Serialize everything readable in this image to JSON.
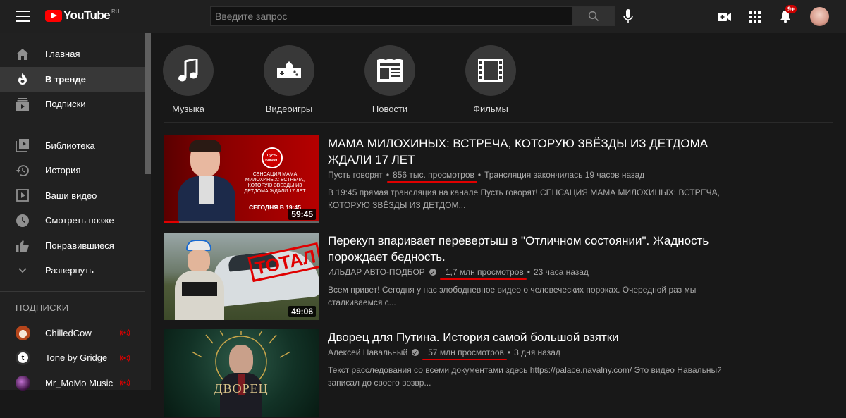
{
  "header": {
    "logo_text": "YouTube",
    "logo_region": "RU",
    "search_placeholder": "Введите запрос",
    "notification_badge": "9+"
  },
  "sidebar": {
    "main_items": [
      {
        "label": "Главная",
        "icon": "home-icon"
      },
      {
        "label": "В тренде",
        "icon": "trending-icon",
        "active": true
      },
      {
        "label": "Подписки",
        "icon": "subscriptions-icon"
      }
    ],
    "library_items": [
      {
        "label": "Библиотека",
        "icon": "library-icon"
      },
      {
        "label": "История",
        "icon": "history-icon"
      },
      {
        "label": "Ваши видео",
        "icon": "your-videos-icon"
      },
      {
        "label": "Смотреть позже",
        "icon": "watch-later-icon"
      },
      {
        "label": "Понравившиеся",
        "icon": "liked-icon"
      },
      {
        "label": "Развернуть",
        "icon": "chevron-down-icon"
      }
    ],
    "subscriptions_heading": "ПОДПИСКИ",
    "subscriptions": [
      {
        "label": "ChilledCow",
        "live": true
      },
      {
        "label": "Tone by Gridge",
        "live": true
      },
      {
        "label": "Mr_MoMo Music",
        "live": true
      }
    ]
  },
  "categories": [
    {
      "label": "Музыка",
      "icon": "music-icon"
    },
    {
      "label": "Видеоигры",
      "icon": "gamepad-icon"
    },
    {
      "label": "Новости",
      "icon": "news-icon"
    },
    {
      "label": "Фильмы",
      "icon": "film-icon"
    }
  ],
  "videos": [
    {
      "title": "МАМА МИЛОХИНЫХ: ВСТРЕЧА, КОТОРУЮ ЗВЁЗДЫ ИЗ ДЕТДОМА ЖДАЛИ 17 ЛЕТ",
      "channel": "Пусть говорят",
      "verified": false,
      "views": "856 тыс. просмотров",
      "time": "Трансляция закончилась 19 часов назад",
      "description": "В 19:45 прямая трансляция на канале Пусть говорят! СЕНСАЦИЯ МАМА МИЛОХИНЫХ: ВСТРЕЧА, КОТОРУЮ ЗВЁЗДЫ ИЗ ДЕТДОМ...",
      "duration": "59:45",
      "thumb_caption": "СЕНСАЦИЯ МАМА МИЛОХИНЫХ: ВСТРЕЧА, КОТОРУЮ ЗВЁЗДЫ ИЗ ДЕТДОМА ЖДАЛИ 17 ЛЕТ",
      "thumb_caption2": "СЕГОДНЯ В 19:45",
      "thumb_logo": "Пусть говорят",
      "watched_fraction": 0.1
    },
    {
      "title": "Перекуп впаривает перевертыш в \"Отличном состоянии\". Жадность порождает бедность.",
      "channel": "ИЛЬДАР АВТО-ПОДБОР",
      "verified": true,
      "views": "1,7 млн просмотров",
      "time": "23 часа назад",
      "description": "Всем привет! Сегодня у нас злободневное видео о человеческих пороках. Очередной раз мы сталкиваемся с...",
      "duration": "49:06",
      "thumb_caption": "ТОТАЛ"
    },
    {
      "title": "Дворец для Путина. История самой большой взятки",
      "channel": "Алексей Навальный",
      "verified": true,
      "views": "57 млн просмотров",
      "time": "3 дня назад",
      "description": "Текст расследования со всеми документами здесь https://palace.navalny.com/ Это видео Навальный записал до своего возвр...",
      "thumb_caption": "ДВОРЕЦ"
    }
  ]
}
